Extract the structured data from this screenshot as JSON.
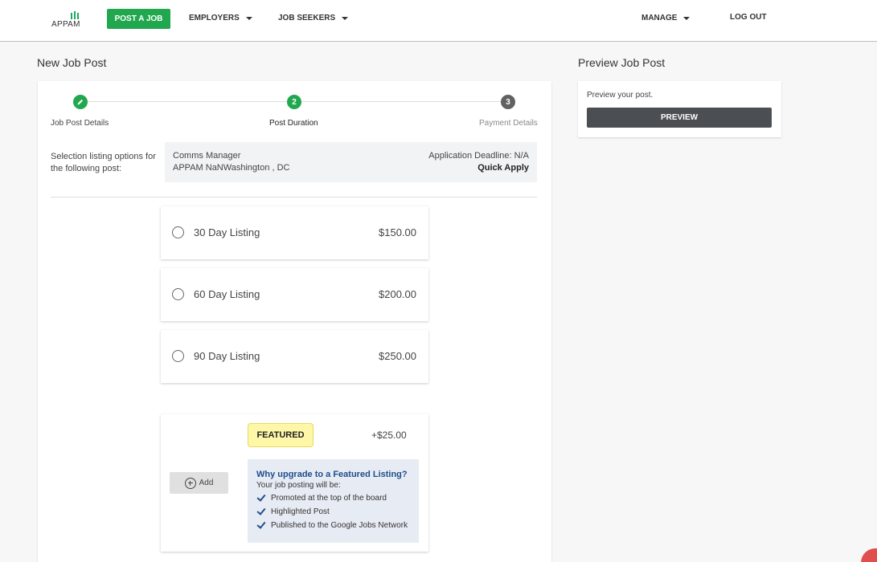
{
  "nav": {
    "logo_text": "APPAM",
    "post_job": "POST A JOB",
    "employers": "EMPLOYERS",
    "job_seekers": "JOB SEEKERS",
    "manage": "MANAGE",
    "logout": "LOG OUT",
    "accent": "#21a84f"
  },
  "left_heading": "New Job Post",
  "right_heading": "Preview Job Post",
  "stepper": {
    "steps": [
      {
        "label": "Job Post Details",
        "state": "complete",
        "icon": "pencil-icon"
      },
      {
        "label": "Post Duration",
        "state": "active",
        "number": "2"
      },
      {
        "label": "Payment Details",
        "state": "pending",
        "number": "3"
      }
    ]
  },
  "selection": {
    "label": "Selection listing options for the following post:",
    "job_title": "Comms Manager",
    "location": "APPAM NaNWashington , DC",
    "deadline": "Application Deadline: N/A",
    "apply_type": "Quick Apply"
  },
  "options": [
    {
      "name": "30 Day Listing",
      "price": "$150.00"
    },
    {
      "name": "60 Day Listing",
      "price": "$200.00"
    },
    {
      "name": "90 Day Listing",
      "price": "$250.00"
    }
  ],
  "featured": {
    "badge": "FEATURED",
    "price": "+$25.00",
    "add_label": "Add",
    "why_title": "Why upgrade to a Featured Listing?",
    "why_sub": "Your job posting will be:",
    "benefits": [
      "Promoted at the top of the board",
      "Highlighted Post",
      "Published to the Google Jobs Network"
    ]
  },
  "preview": {
    "text": "Preview your post.",
    "button": "PREVIEW"
  }
}
